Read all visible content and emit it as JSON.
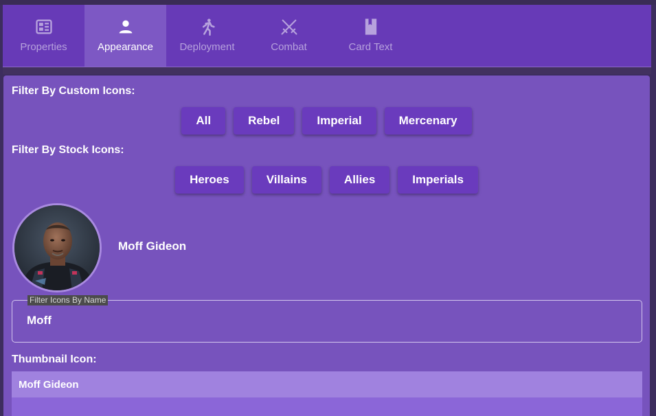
{
  "tabs": [
    {
      "label": "Properties",
      "icon": "properties-icon",
      "active": false
    },
    {
      "label": "Appearance",
      "icon": "person-icon",
      "active": true
    },
    {
      "label": "Deployment",
      "icon": "running-person-icon",
      "active": false
    },
    {
      "label": "Combat",
      "icon": "crossed-swords-icon",
      "active": false
    },
    {
      "label": "Card Text",
      "icon": "card-icon",
      "active": false
    }
  ],
  "filters": {
    "custom_label": "Filter By Custom Icons:",
    "custom_buttons": [
      "All",
      "Rebel",
      "Imperial",
      "Mercenary"
    ],
    "stock_label": "Filter By Stock Icons:",
    "stock_buttons": [
      "Heroes",
      "Villains",
      "Allies",
      "Imperials"
    ]
  },
  "selected": {
    "name": "Moff Gideon"
  },
  "search": {
    "label": "Filter Icons By Name",
    "value": "Moff"
  },
  "thumbnail": {
    "label": "Thumbnail Icon:",
    "items": [
      "Moff Gideon"
    ]
  },
  "colors": {
    "accent": "#673ab7",
    "panel": "#7753bd",
    "button": "#6a3bbd"
  }
}
